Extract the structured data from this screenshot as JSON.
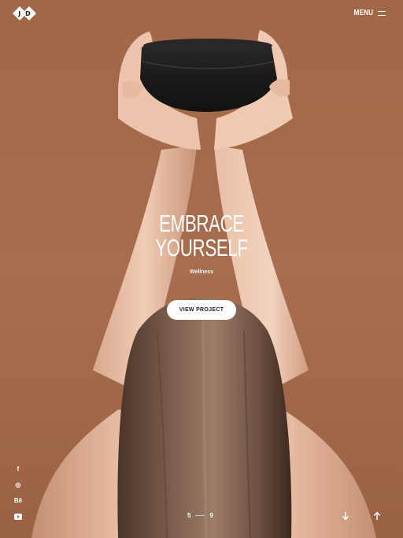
{
  "header": {
    "logo_letter_left": "J",
    "logo_letter_right": "D",
    "menu_label": "MENU",
    "menu_icon": "hamburger-icon"
  },
  "hero": {
    "title_line_1": "EMBRACE",
    "title_line_2": "YOURSELF",
    "category": "Wellness",
    "cta_label": "VIEW PROJECT",
    "background_color": "#a36a4c"
  },
  "social": [
    {
      "name": "facebook",
      "glyph": "f"
    },
    {
      "name": "dribbble",
      "glyph": "◎"
    },
    {
      "name": "behance",
      "glyph": "Bē"
    },
    {
      "name": "youtube",
      "glyph": "▶"
    }
  ],
  "pager": {
    "current": "5",
    "total": "9"
  },
  "nav": {
    "scroll_down_icon": "arrow-down-icon",
    "scroll_top_icon": "arrow-up-icon"
  }
}
